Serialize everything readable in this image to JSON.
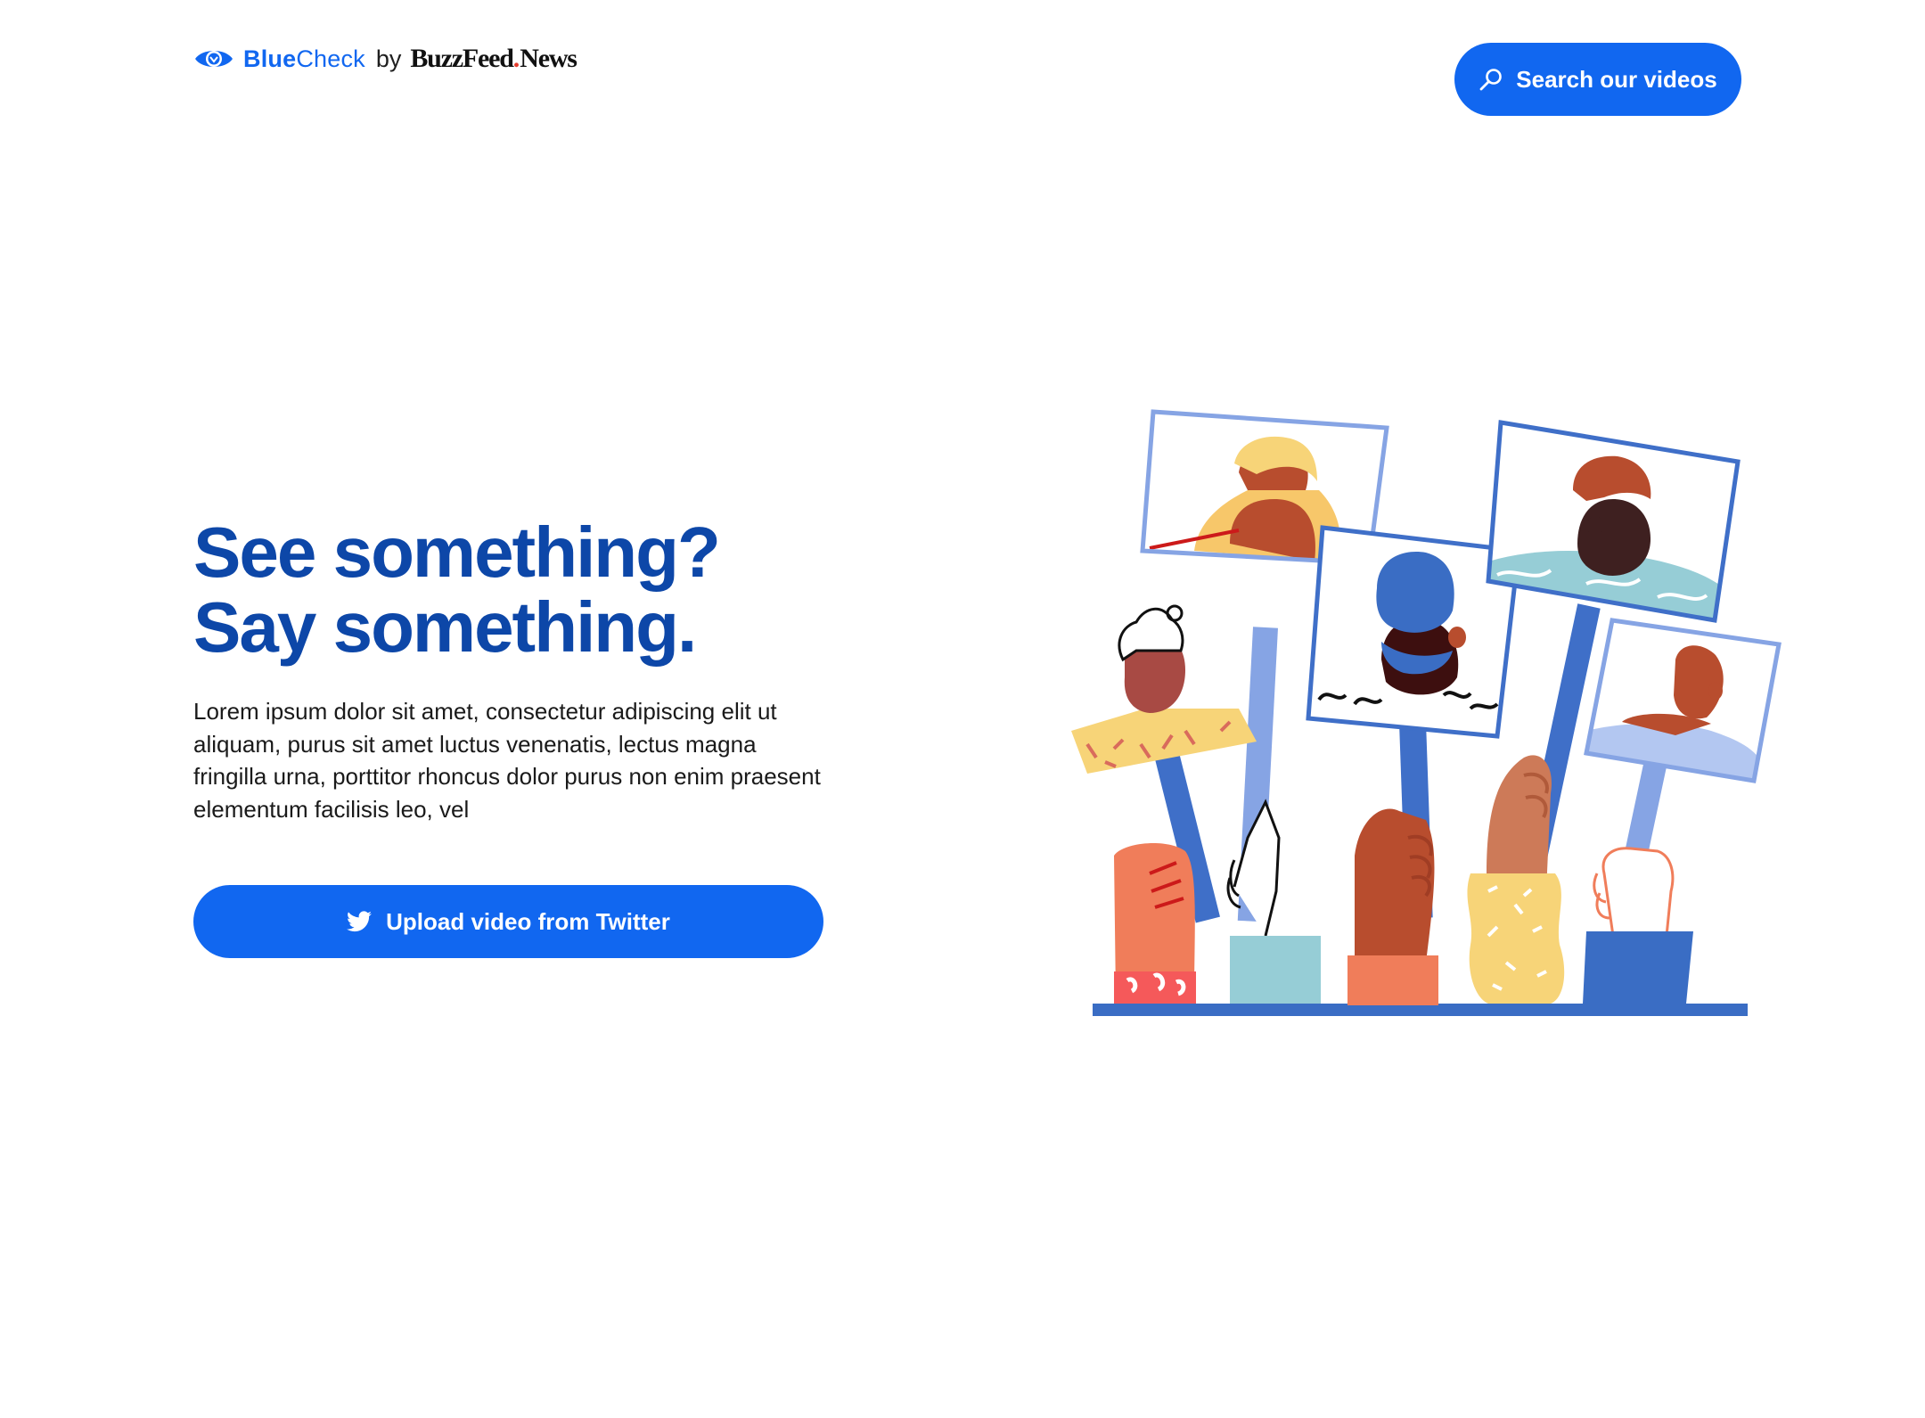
{
  "header": {
    "logo": {
      "brand_bold": "Blue",
      "brand_regular": "Check",
      "by": "by",
      "partner_buzzfeed": "BuzzFeed",
      "partner_news": "News",
      "icon": "eye-icon"
    },
    "search_button": {
      "label": "Search our videos",
      "icon": "search-icon"
    }
  },
  "hero": {
    "headline_line1": "See something?",
    "headline_line2": "Say something.",
    "body": "Lorem ipsum dolor sit amet, consectetur adipiscing elit ut aliquam, purus sit amet luctus venenatis, lectus magna fringilla urna, porttitor rhoncus dolor purus non enim praesent elementum facilisis leo, vel",
    "upload_button": {
      "label": "Upload video from Twitter",
      "icon": "twitter-icon"
    }
  },
  "colors": {
    "primary": "#1167f0",
    "headline": "#0d47a8",
    "accent_red": "#e53b2c"
  }
}
